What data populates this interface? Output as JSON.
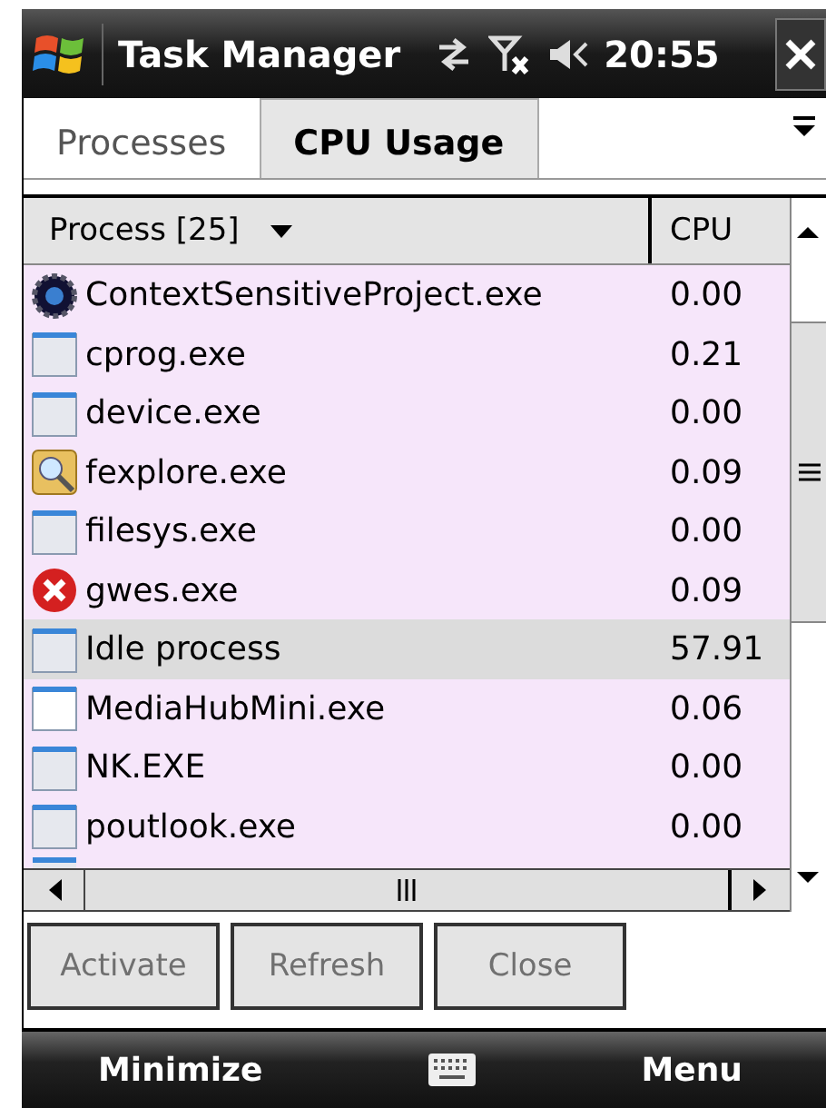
{
  "title_bar": {
    "title": "Task Manager",
    "time": "20:55"
  },
  "tabs": [
    {
      "label": "Processes",
      "selected": false
    },
    {
      "label": "CPU Usage",
      "selected": true
    }
  ],
  "table": {
    "columns": [
      "Process [25]",
      "CPU"
    ],
    "rows": [
      {
        "kind": "gear",
        "name": "ContextSensitiveProject.exe",
        "cpu": "0.00",
        "selected": false
      },
      {
        "kind": "window",
        "name": "cprog.exe",
        "cpu": "0.21",
        "selected": false
      },
      {
        "kind": "window",
        "name": "device.exe",
        "cpu": "0.00",
        "selected": false
      },
      {
        "kind": "search",
        "name": "fexplore.exe",
        "cpu": "0.09",
        "selected": false
      },
      {
        "kind": "window",
        "name": "filesys.exe",
        "cpu": "0.00",
        "selected": false
      },
      {
        "kind": "error",
        "name": "gwes.exe",
        "cpu": "0.09",
        "selected": false
      },
      {
        "kind": "window",
        "name": "Idle process",
        "cpu": "57.91",
        "selected": true
      },
      {
        "kind": "app",
        "name": "MediaHubMini.exe",
        "cpu": "0.06",
        "selected": false
      },
      {
        "kind": "window",
        "name": "NK.EXE",
        "cpu": "0.00",
        "selected": false
      },
      {
        "kind": "window",
        "name": "poutlook.exe",
        "cpu": "0.00",
        "selected": false
      }
    ]
  },
  "buttons": [
    {
      "label": "Activate",
      "disabled": true
    },
    {
      "label": "Refresh",
      "disabled": true
    },
    {
      "label": "Close",
      "disabled": true
    }
  ],
  "softkeys": {
    "left": "Minimize",
    "right": "Menu"
  }
}
